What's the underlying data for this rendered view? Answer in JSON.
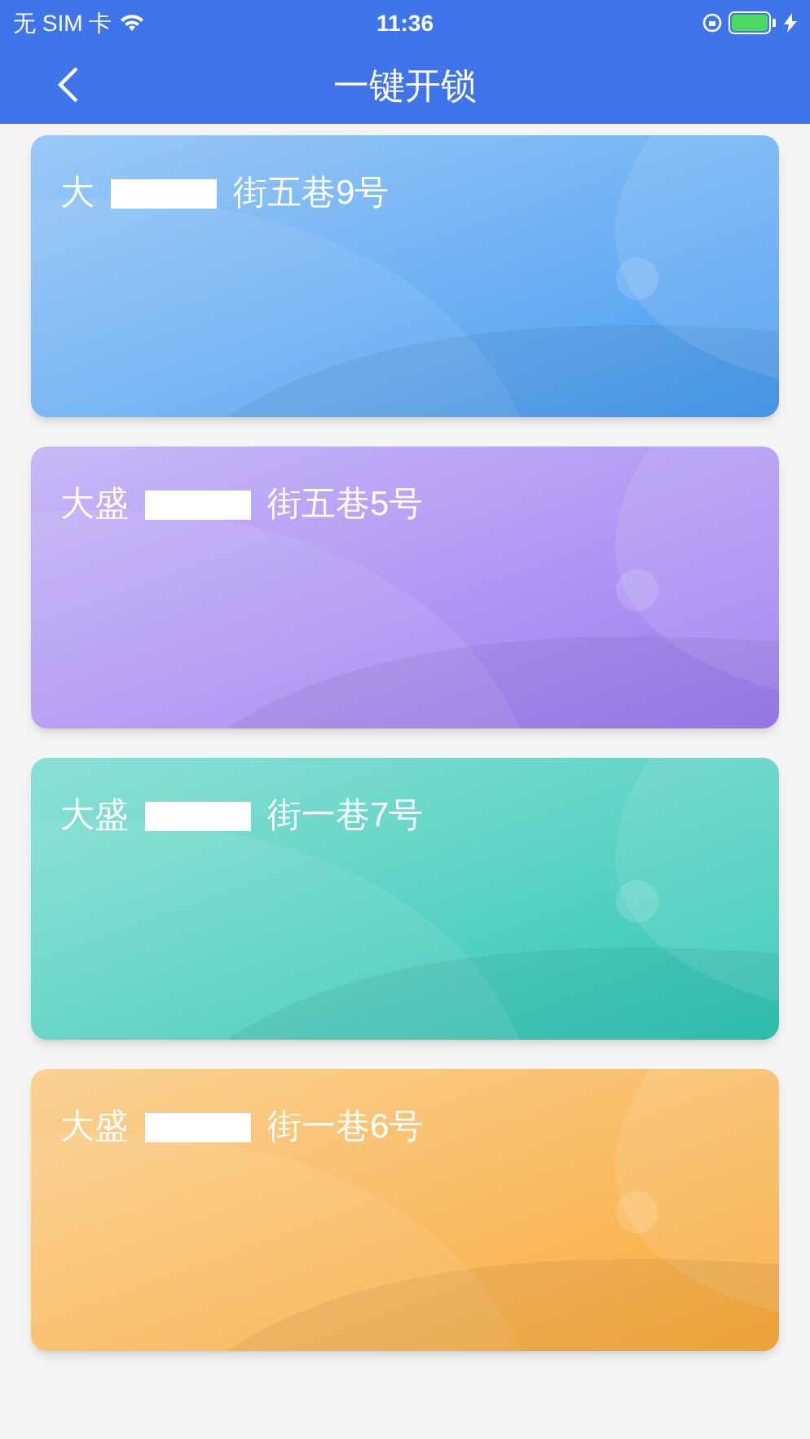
{
  "status_bar": {
    "carrier": "无 SIM 卡",
    "time": "11:36"
  },
  "nav": {
    "title": "一键开锁"
  },
  "cards": [
    {
      "prefix": "大",
      "suffix": "街五巷9号",
      "color": "#4a9df0"
    },
    {
      "prefix": "大盛",
      "suffix": "街五巷5号",
      "color": "#9b7ef0"
    },
    {
      "prefix": "大盛",
      "suffix": "街一巷7号",
      "color": "#2fc7b5"
    },
    {
      "prefix": "大盛",
      "suffix": "街一巷6号",
      "color": "#f8ab3c"
    }
  ]
}
